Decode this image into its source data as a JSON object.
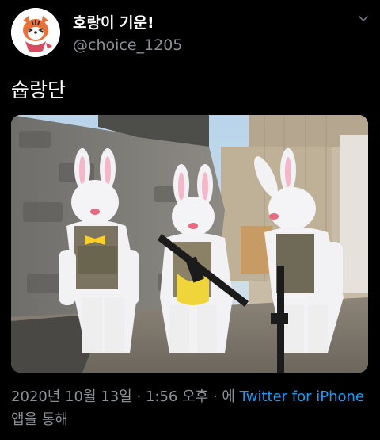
{
  "tweet": {
    "display_name": "호랑이 기운!",
    "handle": "@choice_1205",
    "text": "슙랑단"
  },
  "footer": {
    "date": "2020년 10월 13일",
    "sep1": "·",
    "time": "1:56 오후",
    "sep2": "·",
    "prefix": "에 ",
    "source_link": "Twitter for iPhone",
    "suffix": " 앱을 통해"
  },
  "icons": {
    "menu": "chevron-down-icon",
    "avatar": "tiger-avatar"
  },
  "colors": {
    "background": "#000000",
    "handle": "#8a9196",
    "link": "#1d9bf0"
  }
}
